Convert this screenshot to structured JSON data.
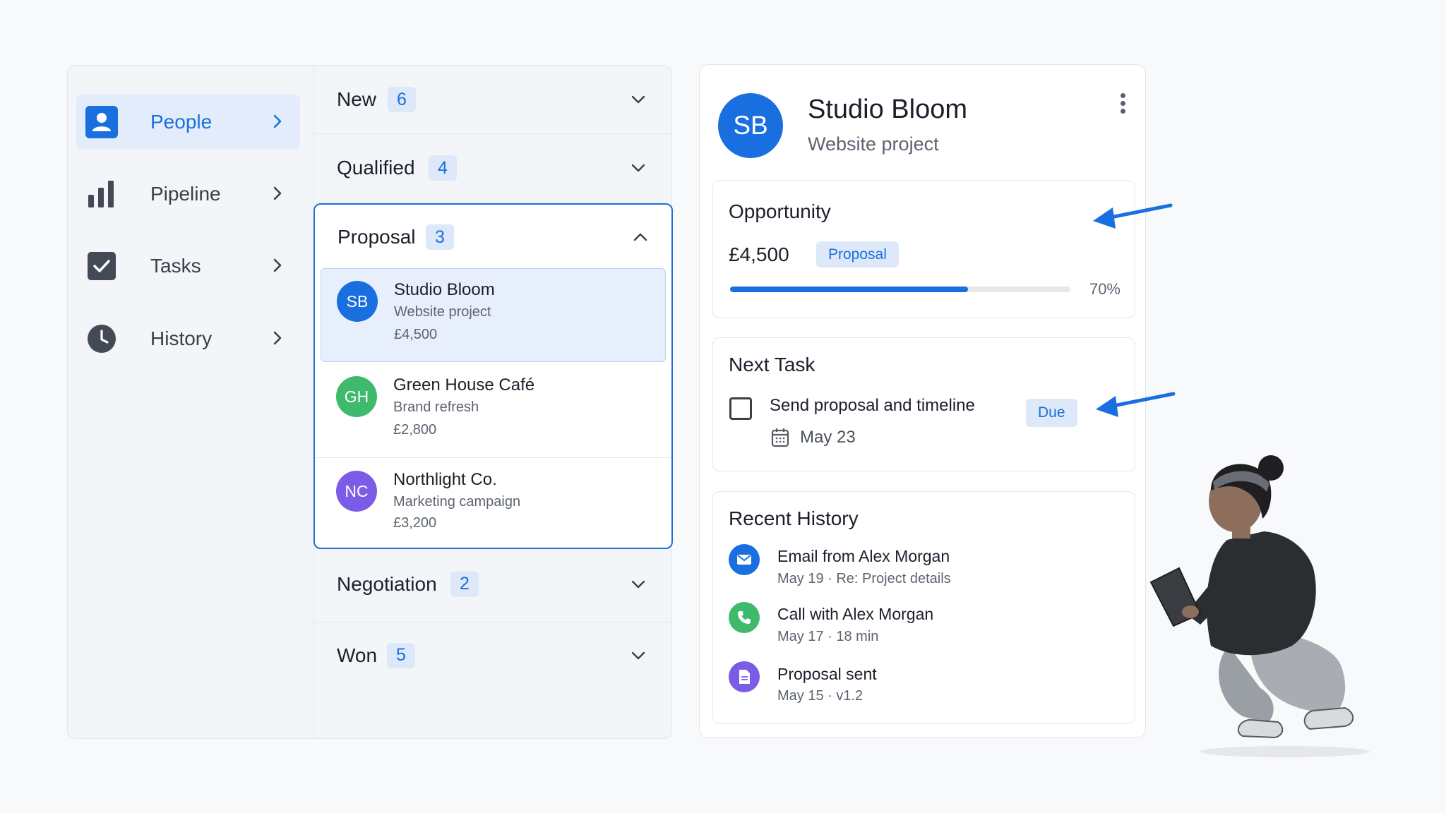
{
  "sidebar": {
    "items": [
      {
        "label": "People",
        "icon": "person-icon",
        "active": true
      },
      {
        "label": "Pipeline",
        "icon": "bar-chart-icon",
        "active": false
      },
      {
        "label": "Tasks",
        "icon": "checkbox-icon",
        "active": false
      },
      {
        "label": "History",
        "icon": "clock-icon",
        "active": false
      }
    ]
  },
  "pipeline": {
    "stages": [
      {
        "name": "New",
        "count": "6",
        "expanded": false
      },
      {
        "name": "Qualified",
        "count": "4",
        "expanded": false
      },
      {
        "name": "Proposal",
        "count": "3",
        "expanded": true
      },
      {
        "name": "Negotiation",
        "count": "2",
        "expanded": false
      },
      {
        "name": "Won",
        "count": "5",
        "expanded": false
      }
    ],
    "deals": [
      {
        "initials": "SB",
        "name": "Studio Bloom",
        "project": "Website project",
        "value": "£4,500",
        "color": "#1a6fe0",
        "selected": true
      },
      {
        "initials": "GH",
        "name": "Green House Café",
        "project": "Brand refresh",
        "value": "£2,800",
        "color": "#3fba6d",
        "selected": false
      },
      {
        "initials": "NC",
        "name": "Northlight Co.",
        "project": "Marketing campaign",
        "value": "£3,200",
        "color": "#7b5ce6",
        "selected": false
      }
    ]
  },
  "detail": {
    "initials": "SB",
    "title": "Studio Bloom",
    "subtitle": "Website project",
    "opportunity": {
      "heading": "Opportunity",
      "amount": "£4,500",
      "stage": "Proposal",
      "progress": 0.7,
      "progress_label": "70%"
    },
    "next_task": {
      "heading": "Next Task",
      "text": "Send proposal and timeline",
      "status": "Due",
      "date": "May 23"
    },
    "history": {
      "heading": "Recent History",
      "items": [
        {
          "icon": "mail-icon",
          "title": "Email from Alex Morgan",
          "meta": "May 19  ·  Re: Project details",
          "color": "#1a6fe0"
        },
        {
          "icon": "phone-icon",
          "title": "Call with Alex Morgan",
          "meta": "May 17  ·  18 min",
          "color": "#3fba6d"
        },
        {
          "icon": "document-icon",
          "title": "Proposal sent",
          "meta": "May 15  ·  v1.2",
          "color": "#7b5ce6"
        }
      ]
    }
  },
  "colors": {
    "accent": "#1a6fe0",
    "accent_soft": "#dde8f8",
    "green": "#3fba6d",
    "purple": "#7b5ce6"
  }
}
